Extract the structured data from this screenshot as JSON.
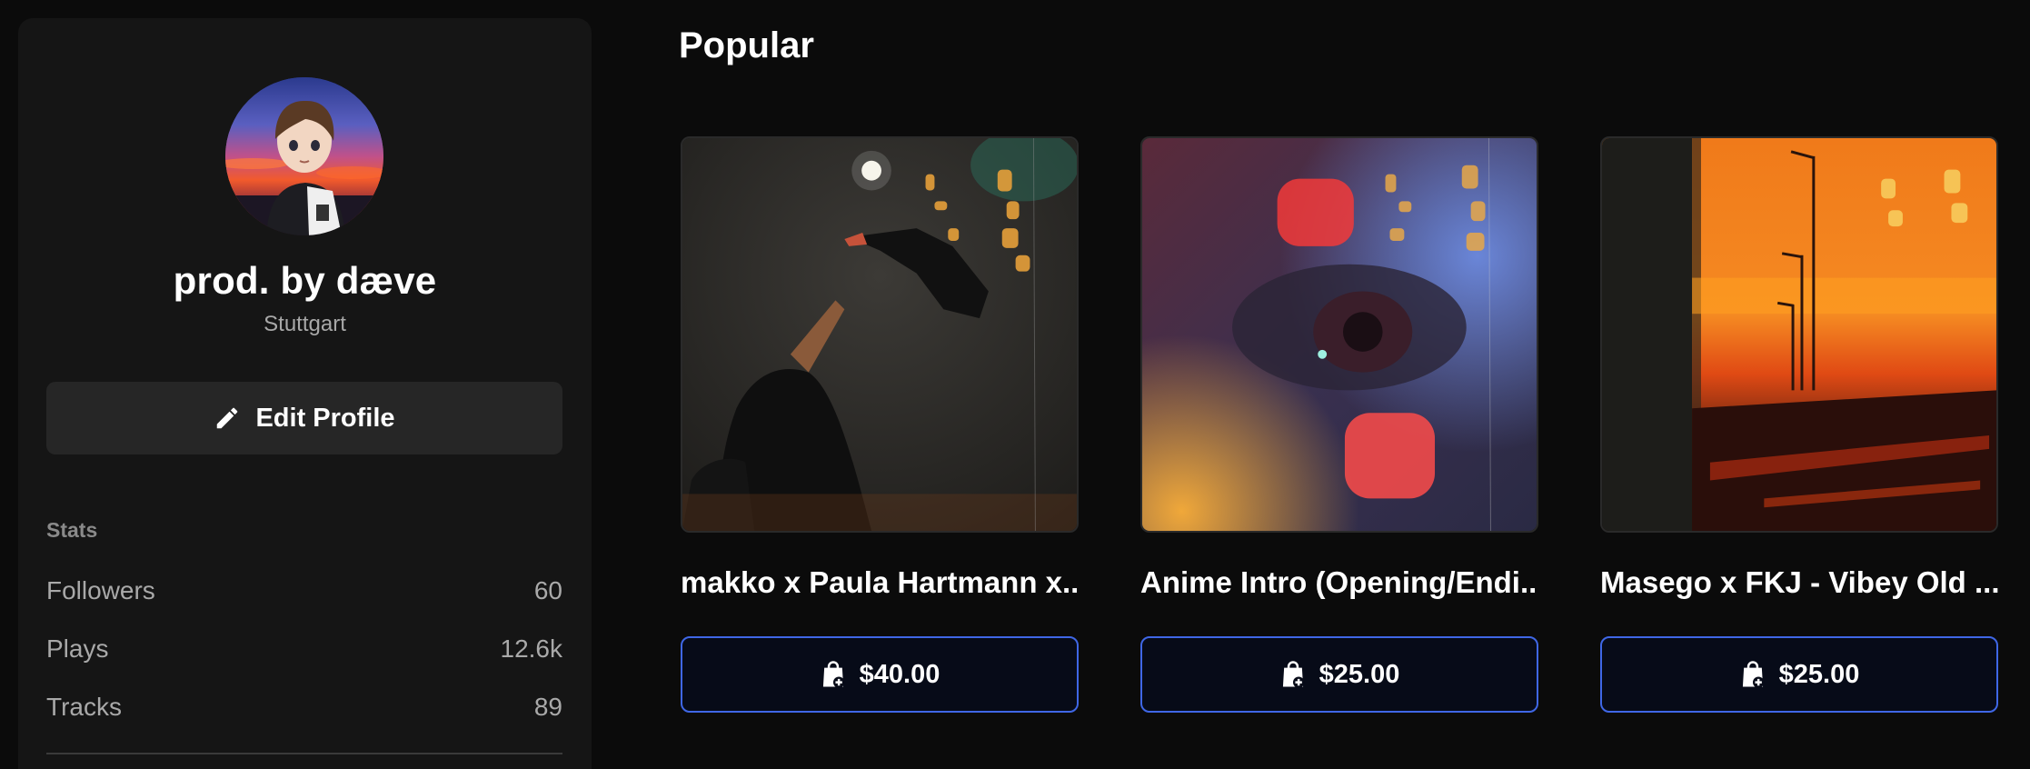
{
  "profile": {
    "name": "prod. by dæve",
    "location": "Stuttgart",
    "edit_label": "Edit Profile"
  },
  "stats": {
    "heading": "Stats",
    "rows": [
      {
        "label": "Followers",
        "value": "60"
      },
      {
        "label": "Plays",
        "value": "12.6k"
      },
      {
        "label": "Tracks",
        "value": "89"
      }
    ]
  },
  "popular": {
    "title": "Popular",
    "items": [
      {
        "title": "makko x Paula Hartmann x...",
        "price": "$40.00"
      },
      {
        "title": "Anime Intro (Opening/Endi...",
        "price": "$25.00"
      },
      {
        "title": "Masego x FKJ - Vibey Old ...",
        "price": "$25.00"
      }
    ]
  },
  "colors": {
    "background": "#0b0b0b",
    "sidebar": "#151515",
    "accent_border": "#3f67e6"
  },
  "icons": {
    "edit": "pencil-icon",
    "price": "shopping-bag-add-icon"
  }
}
